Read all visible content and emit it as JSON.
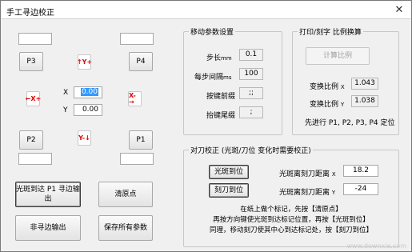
{
  "window": {
    "title": "手工寻边校正",
    "close": "✕"
  },
  "points": {
    "p3": "P3",
    "p4": "P4",
    "p2": "P2",
    "p1": "P1",
    "p3_field": "",
    "p4_field": "",
    "p2_field": "",
    "p1_field": ""
  },
  "arrows": {
    "up": "↑Y+",
    "down": "Y-↓",
    "left": "←X+",
    "right": "X-→"
  },
  "coords": {
    "x_label": "X",
    "x_value": "0.00",
    "y_label": "Y",
    "y_value": "0.00"
  },
  "buttons": {
    "spot_to_p1": "光斑到达 P1 寻边输出",
    "clear_origin": "清原点",
    "non_edge_output": "非寻边输出",
    "save_all": "保存所有参数"
  },
  "move_params": {
    "title": "移动参数设置",
    "step_label": "步长",
    "step_unit": "mm",
    "step_value": "0.1",
    "interval_label": "每步间隔",
    "interval_unit": "ms",
    "interval_value": "100",
    "prefix_label": "按键前缀",
    "prefix_value": ";;",
    "suffix_label": "抬键尾缀",
    "suffix_value": ";"
  },
  "print_ratio": {
    "title": "打印/刻字 比例换算",
    "calc_button": "计算比例",
    "ratio_x_label": "变换比例",
    "ratio_x_axis": "X",
    "ratio_x_value": "1.043",
    "ratio_y_label": "变换比例",
    "ratio_y_axis": "Y",
    "ratio_y_value": "1.038",
    "hint": "先进行 P1, P2, P3, P4 定位"
  },
  "align": {
    "title": "对刀校正 (光斑/刀位 变化时需要校正)",
    "spot_button": "光斑到位",
    "knife_button": "刻刀到位",
    "dist_x_label": "光斑离刻刀距离",
    "dist_x_axis": "X",
    "dist_x_value": "18.2",
    "dist_y_label": "光斑离刻刀距离",
    "dist_y_axis": "Y",
    "dist_y_value": "-24",
    "note1": "在纸上做个标记，先按【清原点】",
    "note2": "再按方向键使光斑到达标记位置，再按【光斑到位】",
    "note3": "同理，移动刻刀使其中心到达标记处，按【刻刀到位】"
  },
  "watermark": "www.downxia.com"
}
